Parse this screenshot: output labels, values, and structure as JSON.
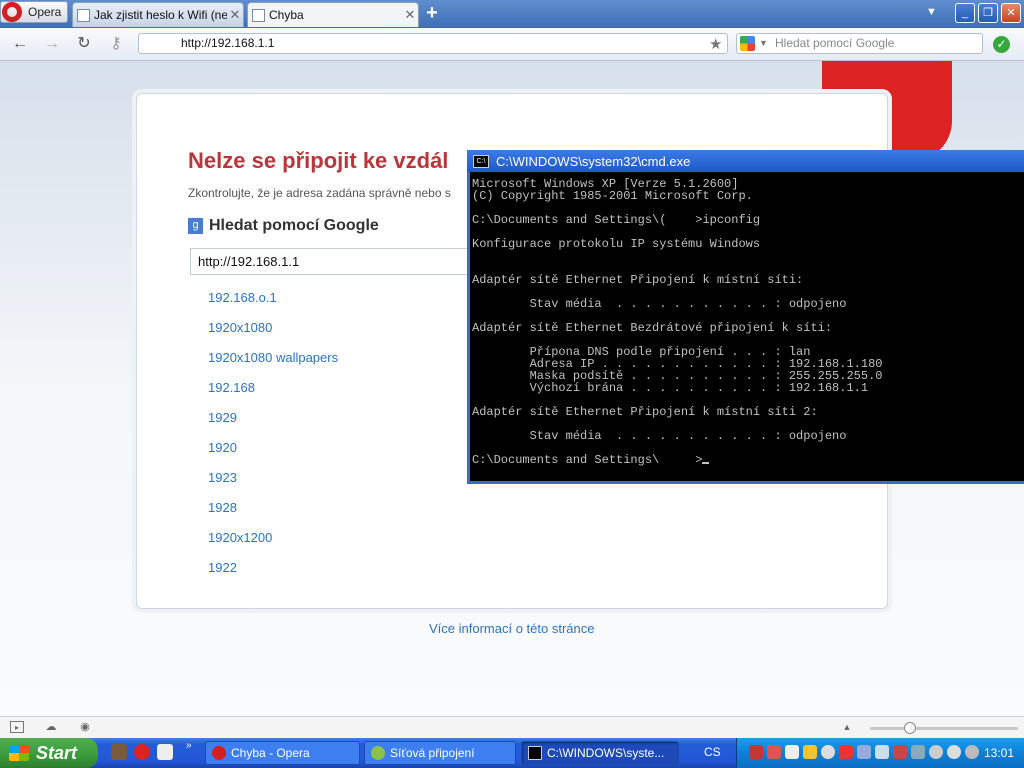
{
  "browser": {
    "menu_label": "Opera",
    "tabs": [
      {
        "title": "Jak zjistit heslo k Wifi (ne...",
        "close": "✕"
      },
      {
        "title": "Chyba",
        "close": "✕"
      }
    ],
    "new_tab": "+",
    "url": "http://192.168.1.1",
    "search_placeholder": "Hledat pomocí Google"
  },
  "error_page": {
    "title": "Nelze se připojit ke vzdál",
    "hint": "Zkontrolujte, že je adresa zadána správně nebo s",
    "google_heading": "Hledat pomocí Google",
    "google_badge": "g",
    "google_input_value": "http://192.168.1.1",
    "suggestions": [
      "192.168.o.1",
      "1920x1080",
      "1920x1080 wallpapers",
      "192.168",
      "1929",
      "1920",
      "1923",
      "1928",
      "1920x1200",
      "1922"
    ],
    "more_info": "Více informací o této stránce"
  },
  "cmd": {
    "title": "C:\\WINDOWS\\system32\\cmd.exe",
    "icon_label": "C:\\",
    "lines": [
      "Microsoft Windows XP [Verze 5.1.2600]",
      "(C) Copyright 1985-2001 Microsoft Corp.",
      "",
      "C:\\Documents and Settings\\(    >ipconfig",
      "",
      "Konfigurace protokolu IP systému Windows",
      "",
      "",
      "Adaptér sítě Ethernet Připojení k místní síti:",
      "",
      "        Stav média  . . . . . . . . . . . : odpojeno",
      "",
      "Adaptér sítě Ethernet Bezdrátové připojení k síti:",
      "",
      "        Přípona DNS podle připojení . . . : lan",
      "        Adresa IP . . . . . . . . . . . . : 192.168.1.180",
      "        Maska podsítě . . . . . . . . . . : 255.255.255.0",
      "        Výchozí brána . . . . . . . . . . : 192.168.1.1",
      "",
      "Adaptér sítě Ethernet Připojení k místní síti 2:",
      "",
      "        Stav média  . . . . . . . . . . . : odpojeno",
      "",
      "C:\\Documents and Settings\\     >"
    ]
  },
  "statusbar": {
    "zoom_fraction": 0.27
  },
  "taskbar": {
    "start_label": "Start",
    "quicklaunch_more": "»",
    "tasks": [
      {
        "label": "Chyba - Opera",
        "icon_color": "#d31f1f"
      },
      {
        "label": "Síťová připojení",
        "icon_color": "#8bc34a"
      },
      {
        "label": "C:\\WINDOWS\\syste...",
        "icon_color": "#000000"
      }
    ],
    "language": "CS",
    "clock": "13:01"
  },
  "colors": {
    "error_title": "#b9363a",
    "link": "#2b74c2",
    "cmd_text": "#c0c0c0",
    "taskbar": "#2256d4",
    "start": "#3a9a3a"
  },
  "icons": {
    "back": "arrow-left-icon",
    "forward": "arrow-right-icon",
    "reload": "reload-icon",
    "wand": "key-icon",
    "favorite": "star-icon",
    "status": "check-icon"
  }
}
